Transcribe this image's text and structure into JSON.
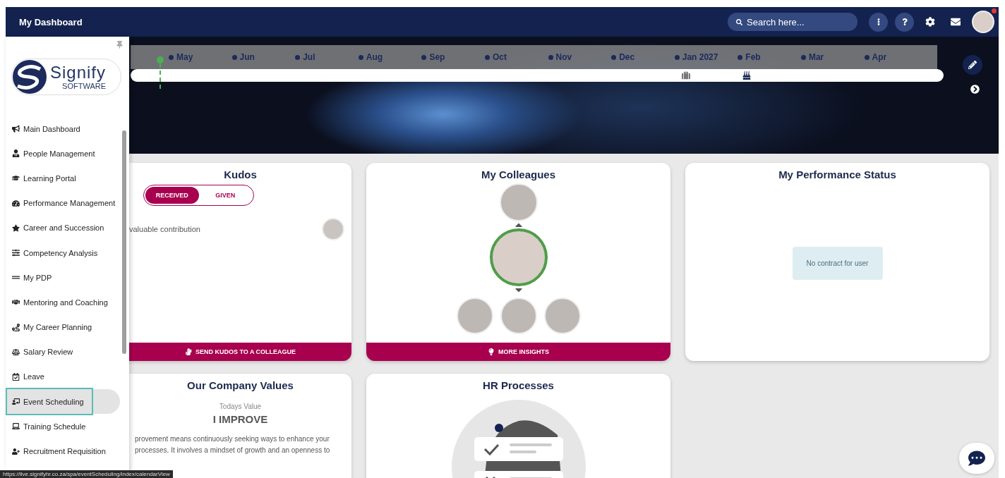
{
  "topbar": {
    "title": "My Dashboard",
    "search": {
      "placeholder": "Search here..."
    },
    "has_notification": true
  },
  "sidebar": {
    "brand": {
      "name": "Signify",
      "tagline": "SOFTWARE"
    },
    "items": [
      {
        "label": "Main Dashboard",
        "selected": false
      },
      {
        "label": "People Management",
        "selected": false
      },
      {
        "label": "Learning Portal",
        "selected": false
      },
      {
        "label": "Performance Management",
        "selected": false
      },
      {
        "label": "Career and Succession",
        "selected": false
      },
      {
        "label": "Competency Analysis",
        "selected": false
      },
      {
        "label": "My PDP",
        "selected": false
      },
      {
        "label": "Mentoring and Coaching",
        "selected": false
      },
      {
        "label": "My Career Planning",
        "selected": false
      },
      {
        "label": "Salary Review",
        "selected": false
      },
      {
        "label": "Leave",
        "selected": false
      },
      {
        "label": "Event Scheduling",
        "selected": true
      },
      {
        "label": "Training Schedule",
        "selected": false
      },
      {
        "label": "Recruitment Requisition",
        "selected": false
      }
    ]
  },
  "timeline": {
    "months": [
      {
        "label": "May",
        "kind": "plain"
      },
      {
        "label": "Jun",
        "kind": "plain"
      },
      {
        "label": "Jul",
        "kind": "plain"
      },
      {
        "label": "Aug",
        "kind": "plain"
      },
      {
        "label": "Sep",
        "kind": "plain"
      },
      {
        "label": "Oct",
        "kind": "plain"
      },
      {
        "label": "Nov",
        "kind": "plain"
      },
      {
        "label": "Dec",
        "kind": "plain"
      },
      {
        "label": "Jan 2027",
        "kind": "leave"
      },
      {
        "label": "Feb",
        "kind": "birthday"
      },
      {
        "label": "Mar",
        "kind": "plain"
      },
      {
        "label": "Apr",
        "kind": "plain"
      }
    ]
  },
  "kudos": {
    "title": "Kudos",
    "tabs": [
      {
        "label": "RECEIVED",
        "selected": true
      },
      {
        "label": "GIVEN",
        "selected": false
      }
    ],
    "entries": [
      {
        "text": "valuable contribution"
      }
    ],
    "action": "SEND KUDOS TO A COLLEAGUE"
  },
  "colleagues": {
    "title": "My Colleagues",
    "people": [
      {
        "kind": "manager"
      },
      {
        "kind": "self"
      },
      {
        "kind": "report"
      },
      {
        "kind": "report"
      },
      {
        "kind": "report"
      }
    ],
    "action": "MORE INSIGHTS"
  },
  "performance": {
    "title": "My Performance Status",
    "message": "No contract for user"
  },
  "values": {
    "title": "Our Company Values",
    "caption": "Todays Value",
    "value": "I IMPROVE",
    "description": "provement means continuously seeking ways to enhance your processes. It involves a mindset of growth and an openness to"
  },
  "hr": {
    "title": "HR Processes"
  },
  "status_link": "https://live.signifyhr.co.za/spa/eventScheduling/index/calendarView"
}
